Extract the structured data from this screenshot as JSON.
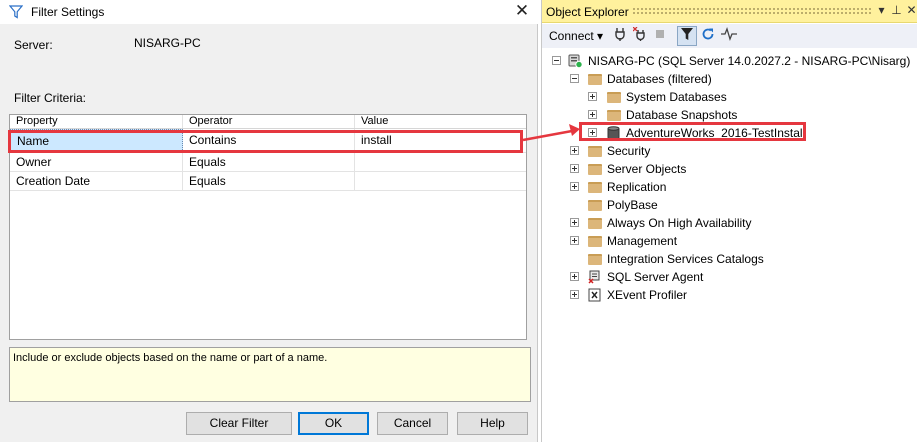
{
  "dialog": {
    "title": "Filter Settings",
    "server_label": "Server:",
    "server_value": "NISARG-PC",
    "criteria_label": "Filter Criteria:",
    "columns": [
      "Property",
      "Operator",
      "Value"
    ],
    "rows": [
      {
        "property": "Name",
        "operator": "Contains",
        "value": "install"
      },
      {
        "property": "Owner",
        "operator": "Equals",
        "value": ""
      },
      {
        "property": "Creation Date",
        "operator": "Equals",
        "value": ""
      }
    ],
    "description": "Include or exclude objects based on the name or part of a name.",
    "buttons": {
      "clear": "Clear Filter",
      "ok": "OK",
      "cancel": "Cancel",
      "help": "Help"
    },
    "close_icon": "close-icon"
  },
  "object_explorer": {
    "title": "Object Explorer",
    "toolbar": {
      "connect": "Connect"
    },
    "tree": {
      "server": "NISARG-PC (SQL Server 14.0.2027.2 - NISARG-PC\\Nisarg)",
      "databases": "Databases (filtered)",
      "system_databases": "System Databases",
      "database_snapshots": "Database Snapshots",
      "adventureworks": "AdventureWorks_2016-TestInstall",
      "security": "Security",
      "server_objects": "Server Objects",
      "replication": "Replication",
      "polybase": "PolyBase",
      "always_on": "Always On High Availability",
      "management": "Management",
      "integration_services": "Integration Services Catalogs",
      "sql_agent": "SQL Server Agent",
      "xevent": "XEvent Profiler"
    }
  },
  "colors": {
    "highlight": "#e5373f",
    "selection": "#cce8ff",
    "title_bar": "#fff19d",
    "description_bg": "#ffffe1"
  }
}
